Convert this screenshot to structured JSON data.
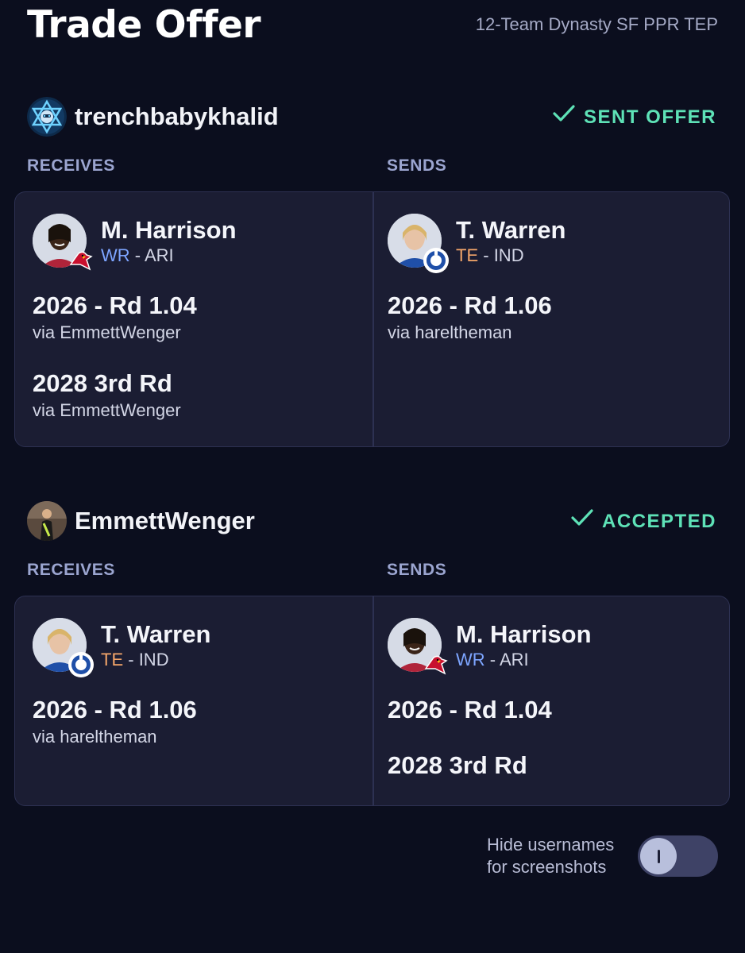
{
  "page": {
    "title": "Trade Offer",
    "league": "12-Team Dynasty SF PPR TEP"
  },
  "parties": [
    {
      "username": "trenchbabykhalid",
      "avatar_icon": "star-of-david-robot-avatar-icon",
      "status": "SENT OFFER",
      "status_icon": "checkmark-icon",
      "receives_label": "RECEIVES",
      "sends_label": "SENDS",
      "receives": {
        "player": {
          "name": "M. Harrison",
          "pos": "WR",
          "sep": " - ",
          "team": "ARI"
        },
        "picks": [
          {
            "title": "2026 - Rd 1.04",
            "via": "via EmmettWenger"
          },
          {
            "title": "2028 3rd Rd",
            "via": "via EmmettWenger"
          }
        ]
      },
      "sends": {
        "player": {
          "name": "T. Warren",
          "pos": "TE",
          "sep": " - ",
          "team": "IND"
        },
        "picks": [
          {
            "title": "2026 - Rd 1.06",
            "via": "via hareltheman"
          }
        ]
      }
    },
    {
      "username": "EmmettWenger",
      "avatar_icon": "person-photo-avatar-icon",
      "status": "ACCEPTED",
      "status_icon": "checkmark-icon",
      "receives_label": "RECEIVES",
      "sends_label": "SENDS",
      "receives": {
        "player": {
          "name": "T. Warren",
          "pos": "TE",
          "sep": " - ",
          "team": "IND"
        },
        "picks": [
          {
            "title": "2026 - Rd 1.06",
            "via": "via hareltheman"
          }
        ]
      },
      "sends": {
        "player": {
          "name": "M. Harrison",
          "pos": "WR",
          "sep": " - ",
          "team": "ARI"
        },
        "picks": [
          {
            "title": "2026 - Rd 1.04"
          },
          {
            "title": "2028 3rd Rd"
          }
        ]
      }
    }
  ],
  "toggle": {
    "label": "Hide usernames for screenshots",
    "on": false
  },
  "colors": {
    "background": "#0b0e1e",
    "card": "#1b1d33",
    "status_green": "#5ee2b7",
    "wr": "#7da5ff",
    "te": "#f5a66a"
  }
}
